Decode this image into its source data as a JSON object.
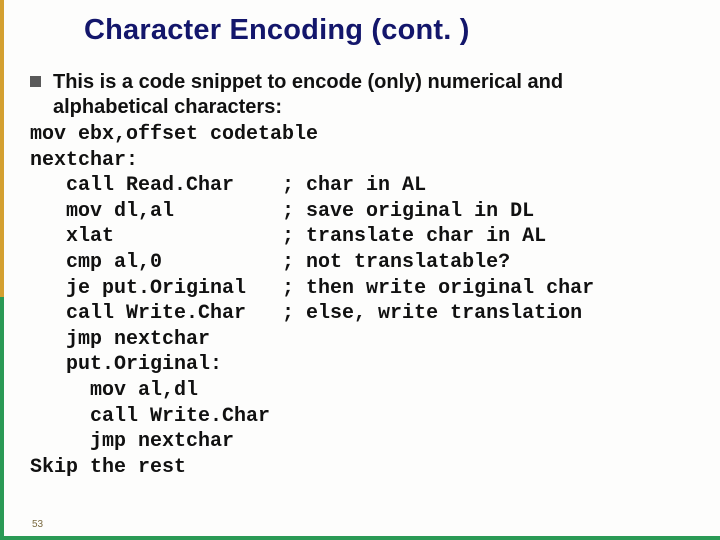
{
  "title": "Character Encoding (cont. )",
  "bullet_line1": "This is a code snippet to encode (only) numerical and",
  "bullet_line2": "alphabetical characters:",
  "code_lines": [
    "mov ebx,offset codetable",
    "nextchar:",
    "   call Read.Char    ; char in AL",
    "   mov dl,al         ; save original in DL",
    "   xlat              ; translate char in AL",
    "   cmp al,0          ; not translatable?",
    "   je put.Original   ; then write original char",
    "   call Write.Char   ; else, write translation",
    "   jmp nextchar",
    "   put.Original:",
    "     mov al,dl",
    "     call Write.Char",
    "     jmp nextchar",
    "Skip the rest"
  ],
  "page_number": "53"
}
